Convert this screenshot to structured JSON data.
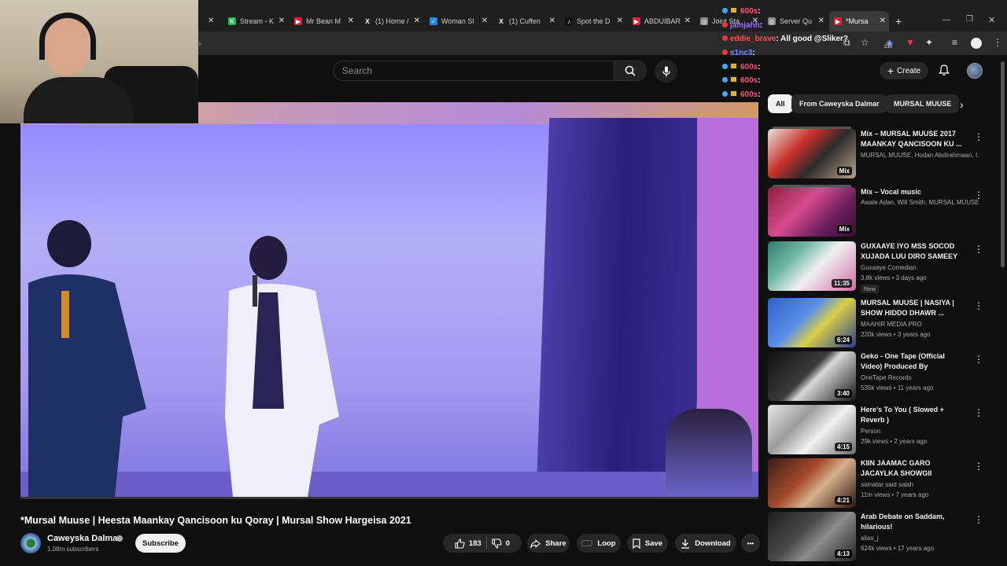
{
  "browser": {
    "tabs": [
      {
        "label": "Stream - K",
        "color": "#1db954",
        "glyph": "K"
      },
      {
        "label": "Mr Bean M",
        "color": "#e01e37",
        "glyph": "▶"
      },
      {
        "label": "(1) Home /",
        "color": "#222222",
        "glyph": "X"
      },
      {
        "label": "Woman Sl",
        "color": "#1e88e5",
        "glyph": "✓"
      },
      {
        "label": "(1) Cuffen",
        "color": "#222222",
        "glyph": "X"
      },
      {
        "label": "Spot the D",
        "color": "#111111",
        "glyph": "♪"
      },
      {
        "label": "ABDUIBAR",
        "color": "#e01e37",
        "glyph": "▶"
      },
      {
        "label": "Joint Sta",
        "color": "#888888",
        "glyph": "◎"
      },
      {
        "label": "Server Qu",
        "color": "#888888",
        "glyph": "◎"
      },
      {
        "label": "*Mursa",
        "color": "#e01e37",
        "glyph": "▶"
      }
    ],
    "extension_count": "210"
  },
  "chat": [
    {
      "user": "600s",
      "color": "#ff4f7a",
      "msg": ":",
      "badges": true
    },
    {
      "user": "jamjahh",
      "color": "#9b6bff",
      "msg": ":",
      "badges": false
    },
    {
      "user": "eddie_brave",
      "color": "#ff4f4f",
      "msg": ": All good @Sliker?",
      "badges": false
    },
    {
      "user": "s1nc3",
      "color": "#6b8cff",
      "msg": ":",
      "badges": false
    },
    {
      "user": "600s",
      "color": "#ff4f7a",
      "msg": ":",
      "badges": true
    },
    {
      "user": "600s",
      "color": "#ff4f7a",
      "msg": ":",
      "badges": true
    },
    {
      "user": "600s",
      "color": "#ff4f7a",
      "msg": ":",
      "badges": true
    }
  ],
  "header": {
    "search_placeholder": "Search",
    "create_label": "Create"
  },
  "video": {
    "title": "*Mursal Muuse | Heesta Maankay Qancisoon ku Qoray | Mursal Show Hargeisa 2021",
    "channel": "Caweyska Dalmar",
    "subscribers": "1.08m subscribers",
    "subscribe_label": "Subscribe",
    "likes": "183",
    "dislikes": "0",
    "share_label": "Share",
    "loop_label": "Loop",
    "save_label": "Save",
    "download_label": "Download",
    "more_label": "•••"
  },
  "chips": [
    "All",
    "From Caweyska Dalmar",
    "MURSAL MUUSE"
  ],
  "recommendations": [
    {
      "title": "Mix – MURSAL MUUSE 2017 MAANKAY QANCISOON KU ...",
      "channel": "MURSAL MUUSE, Hodan Abdirahmaan, I...",
      "meta": "",
      "badge": "Mix",
      "mix": true,
      "new": "",
      "thumb": "linear-gradient(135deg,#e8e2da 0%,#c9302c 35%,#2b2b2b 60%,#b9a48a 100%)"
    },
    {
      "title": "Mix – Vocal music",
      "channel": "Awale Adan, Will Smith, MURSAL MUUSE...",
      "meta": "",
      "badge": "Mix",
      "mix": true,
      "new": "",
      "thumb": "linear-gradient(135deg,#8c1f3d 0%,#d74b8e 40%,#6b1d5c 70%,#3a0f2c 100%)"
    },
    {
      "title": "GUXAAYE IYO MSS SOCOD XUJADA LUU DIRO SAMEEY ...",
      "channel": "Guxaaye Comedian",
      "meta": "3.8k views • 3 days ago",
      "badge": "11:35",
      "mix": false,
      "new": "New",
      "thumb": "linear-gradient(135deg,#2d7e6a 0%,#6fb7a4 30%,#f0f0f0 55%,#d26aa8 100%)"
    },
    {
      "title": "MURSAL MUUSE | NASIYA | SHOW HIDDO DHAWR ...",
      "channel": "MAAHIR MEDIA PRO",
      "meta": "220k views • 3 years ago",
      "badge": "6:24",
      "mix": false,
      "new": "",
      "thumb": "linear-gradient(135deg,#2f61c9 0%,#5a8ee8 40%,#d9cf48 60%,#2a3f8f 100%)"
    },
    {
      "title": "Geko - One Tape (Official Video) Produced By @TrrikzMusic",
      "channel": "OneTape Records",
      "meta": "535k views • 11 years ago",
      "badge": "3:40",
      "mix": false,
      "new": "",
      "thumb": "linear-gradient(135deg,#121212 0%,#3a3a3a 45%,#d8d8d8 55%,#151515 100%)"
    },
    {
      "title": "Here's To You ( Slowed + Reverb )",
      "channel": "Person",
      "meta": "29k views • 2 years ago",
      "badge": "4:15",
      "mix": false,
      "new": "",
      "thumb": "linear-gradient(135deg,#e6e6e6 0%,#9c9c9c 35%,#f2f2f2 60%,#6a6a6a 100%)"
    },
    {
      "title": "KIIN JAAMAC   GARO JACAYLKA SHOWGII   NAIROBI",
      "channel": "samatar said salah",
      "meta": "11m views • 7 years ago",
      "badge": "4:21",
      "mix": false,
      "new": "",
      "thumb": "linear-gradient(135deg,#3b1d16 0%,#a34a2c 40%,#d6b08c 60%,#2a1410 100%)"
    },
    {
      "title": "Arab Debate on Saddam, hilarious!",
      "channel": "alias_j",
      "meta": "624k views • 17 years ago",
      "badge": "4:13",
      "mix": false,
      "new": "",
      "thumb": "linear-gradient(135deg,#1d1d1d 0%,#4a4a4a 40%,#8c8c8c 60%,#222 100%)"
    }
  ]
}
